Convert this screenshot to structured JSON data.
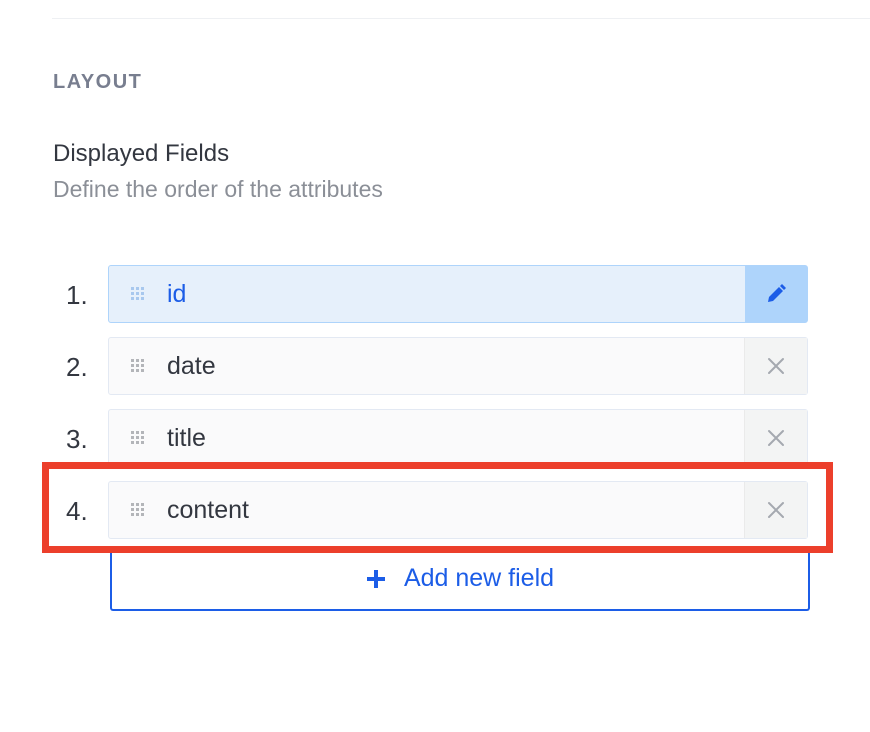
{
  "section_label": "LAYOUT",
  "displayed_fields": {
    "title": "Displayed Fields",
    "description": "Define the order of the attributes"
  },
  "fields": [
    {
      "number": "1.",
      "name": "id",
      "action_icon": "pencil-icon",
      "active": true
    },
    {
      "number": "2.",
      "name": "date",
      "action_icon": "close-icon",
      "active": false
    },
    {
      "number": "3.",
      "name": "title",
      "action_icon": "close-icon",
      "active": false
    },
    {
      "number": "4.",
      "name": "content",
      "action_icon": "close-icon",
      "active": false
    }
  ],
  "add_button": {
    "label": "Add new field",
    "icon": "plus-icon"
  },
  "colors": {
    "accent": "#1c5de7",
    "active_bg": "#e6f0fb",
    "active_action_bg": "#aed4fb",
    "highlight": "#ec3f2b"
  }
}
